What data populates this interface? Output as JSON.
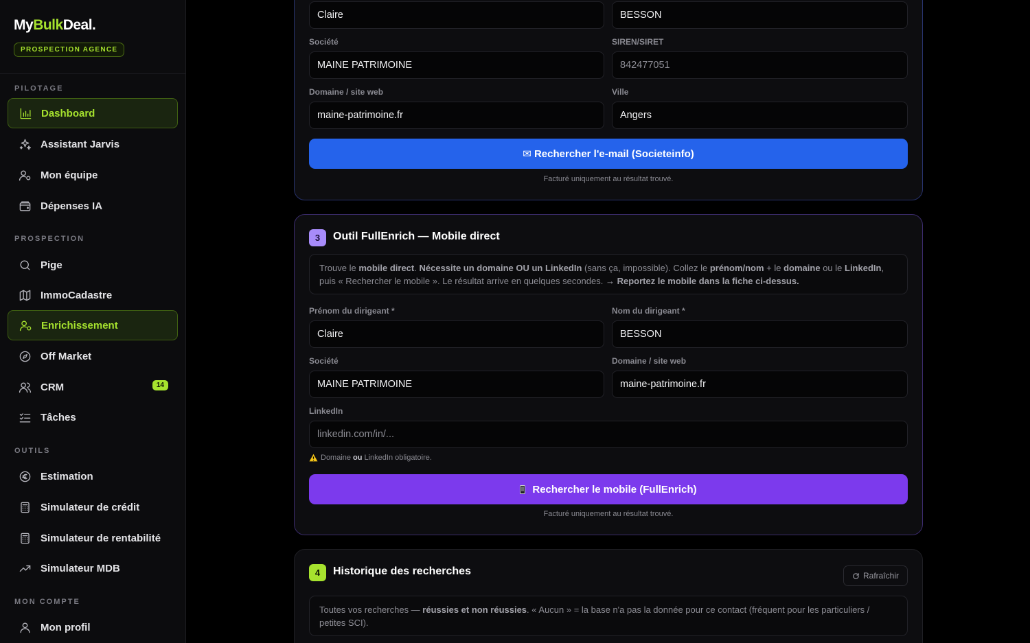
{
  "brand": {
    "logo_a": "My",
    "logo_b": "Bulk",
    "logo_c": "Deal.",
    "badge": "PROSPECTION AGENCE"
  },
  "sections": {
    "pilotage": "PILOTAGE",
    "prospection": "PROSPECTION",
    "outils": "OUTILS",
    "compte": "MON COMPTE"
  },
  "nav": {
    "dashboard": "Dashboard",
    "jarvis": "Assistant Jarvis",
    "equipe": "Mon équipe",
    "depenses": "Dépenses IA",
    "pige": "Pige",
    "immo": "ImmoCadastre",
    "enrich": "Enrichissement",
    "offmarket": "Off Market",
    "crm": "CRM",
    "crm_badge": "14",
    "taches": "Tâches",
    "estimation": "Estimation",
    "credit": "Simulateur de crédit",
    "rentab": "Simulateur de rentabilité",
    "mdb": "Simulateur MDB",
    "profil": "Mon profil"
  },
  "card2": {
    "first_name": "Claire",
    "last_name": "BESSON",
    "societe_label": "Société",
    "societe": "MAINE PATRIMOINE",
    "siren_label": "SIREN/SIRET",
    "siren": "842477051",
    "domaine_label": "Domaine / site web",
    "domaine": "maine-patrimoine.fr",
    "ville_label": "Ville",
    "ville": "Angers",
    "button": "✉ Rechercher l'e-mail (Societeinfo)",
    "note": "Facturé uniquement au résultat trouvé."
  },
  "card3": {
    "num": "3",
    "title": "Outil FullEnrich — Mobile direct",
    "info": {
      "t1": "Trouve le ",
      "b1": "mobile direct",
      "t2": ". ",
      "b2": "Nécessite un domaine OU un LinkedIn",
      "t3": " (sans ça, impossible). Collez le ",
      "b3": "prénom/nom",
      "t4": " + le ",
      "b4": "domaine",
      "t5": " ou le ",
      "b5": "LinkedIn",
      "t6": ", puis « Rechercher le mobile ». Le résultat arrive en quelques secondes. ",
      "b6": "→ Reportez le mobile dans la fiche ci-dessus."
    },
    "prenom_label": "Prénom du dirigeant *",
    "prenom": "Claire",
    "nom_label": "Nom du dirigeant *",
    "nom": "BESSON",
    "societe_label": "Société",
    "societe": "MAINE PATRIMOINE",
    "domaine_label": "Domaine / site web",
    "domaine": "maine-patrimoine.fr",
    "linkedin_label": "LinkedIn",
    "linkedin_placeholder": "linkedin.com/in/...",
    "warn_a": "Domaine",
    "warn_b": "ou",
    "warn_c": "LinkedIn obligatoire.",
    "button": "Rechercher le mobile (FullEnrich)",
    "note": "Facturé uniquement au résultat trouvé."
  },
  "card4": {
    "num": "4",
    "title": "Historique des recherches",
    "refresh": "Rafraîchir",
    "info_a": "Toutes vos recherches — ",
    "info_b": "réussies et non réussies",
    "info_c": ". « Aucun » = la base n'a pas la donnée pour ce contact (fréquent pour les particuliers / petites SCI)."
  },
  "colors": {
    "accent": "#a6e22e",
    "blue": "#2563eb",
    "purple": "#7c3aed"
  }
}
